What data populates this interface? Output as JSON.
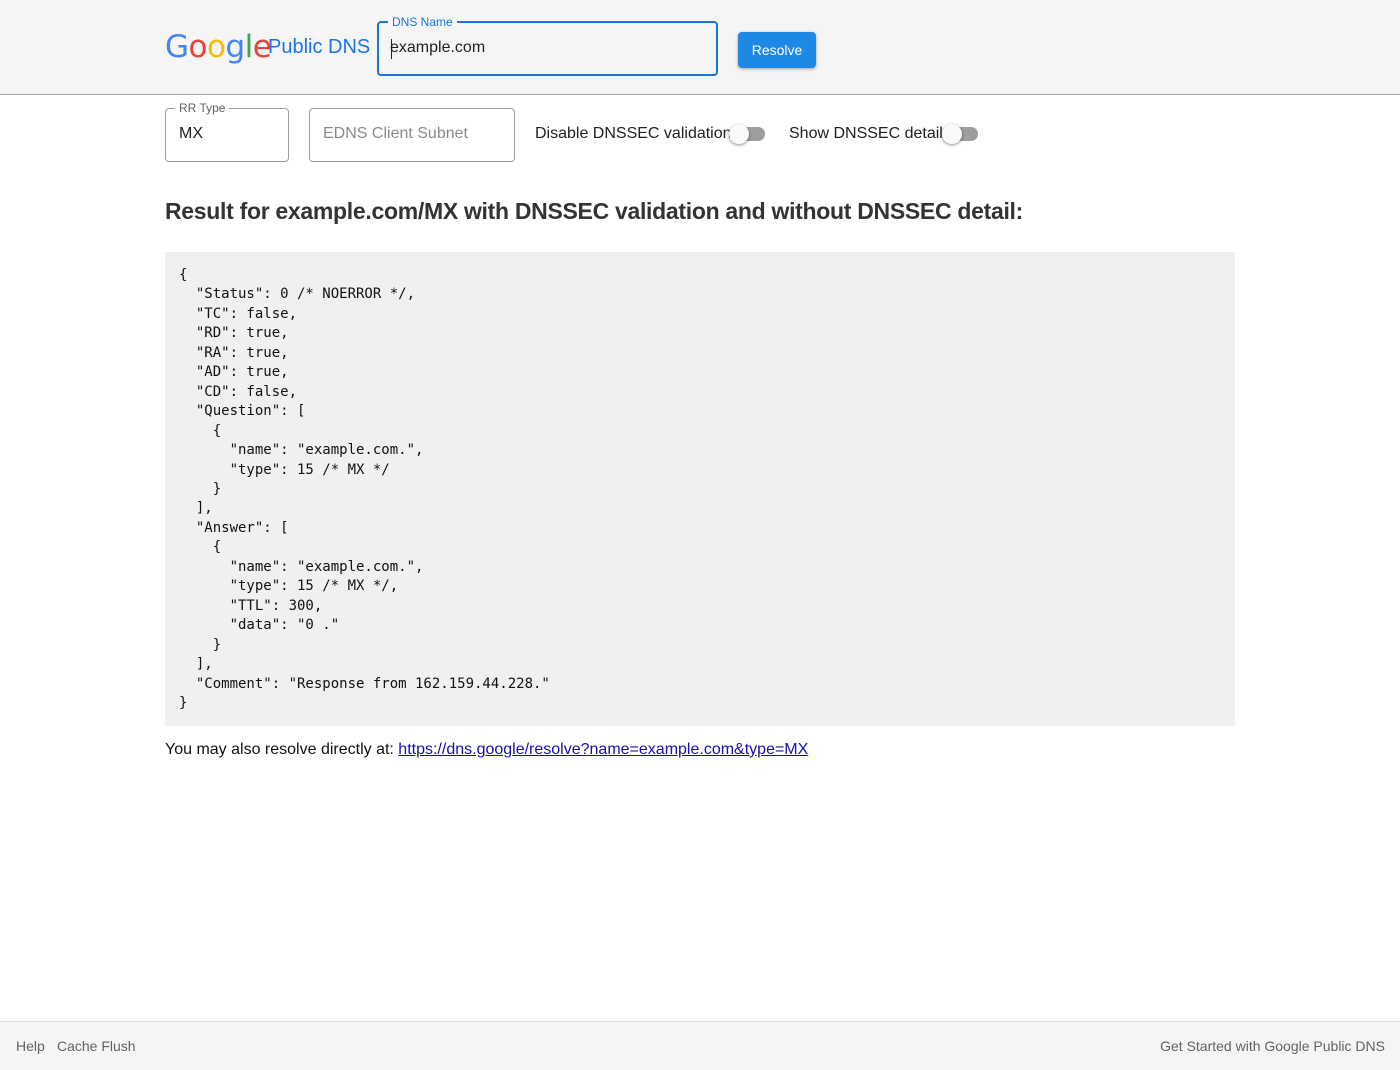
{
  "header": {
    "logo_letters": [
      {
        "ch": "G",
        "color": "#4285F4"
      },
      {
        "ch": "o",
        "color": "#EA4335"
      },
      {
        "ch": "o",
        "color": "#FBBC05"
      },
      {
        "ch": "g",
        "color": "#4285F4"
      },
      {
        "ch": "l",
        "color": "#34A853"
      },
      {
        "ch": "e",
        "color": "#EA4335"
      }
    ],
    "brand": "Public DNS",
    "dns_name_label": "DNS Name",
    "dns_name_value": "example.com",
    "resolve_label": "Resolve"
  },
  "options": {
    "rr_type_label": "RR Type",
    "rr_type_value": "MX",
    "edns_placeholder": "EDNS Client Subnet",
    "disable_dnssec_label": "Disable DNSSEC validation",
    "disable_dnssec_on": false,
    "show_dnssec_label": "Show DNSSEC detail",
    "show_dnssec_on": false
  },
  "result": {
    "title": "Result for example.com/MX with DNSSEC validation and without DNSSEC detail:",
    "json_text": "{\n  \"Status\": 0 /* NOERROR */,\n  \"TC\": false,\n  \"RD\": true,\n  \"RA\": true,\n  \"AD\": true,\n  \"CD\": false,\n  \"Question\": [\n    {\n      \"name\": \"example.com.\",\n      \"type\": 15 /* MX */\n    }\n  ],\n  \"Answer\": [\n    {\n      \"name\": \"example.com.\",\n      \"type\": 15 /* MX */,\n      \"TTL\": 300,\n      \"data\": \"0 .\"\n    }\n  ],\n  \"Comment\": \"Response from 162.159.44.228.\"\n}",
    "also_prefix": "You may also resolve directly at: ",
    "also_link": "https://dns.google/resolve?name=example.com&type=MX"
  },
  "footer": {
    "help": "Help",
    "cache_flush": "Cache Flush",
    "get_started": "Get Started with Google Public DNS"
  }
}
